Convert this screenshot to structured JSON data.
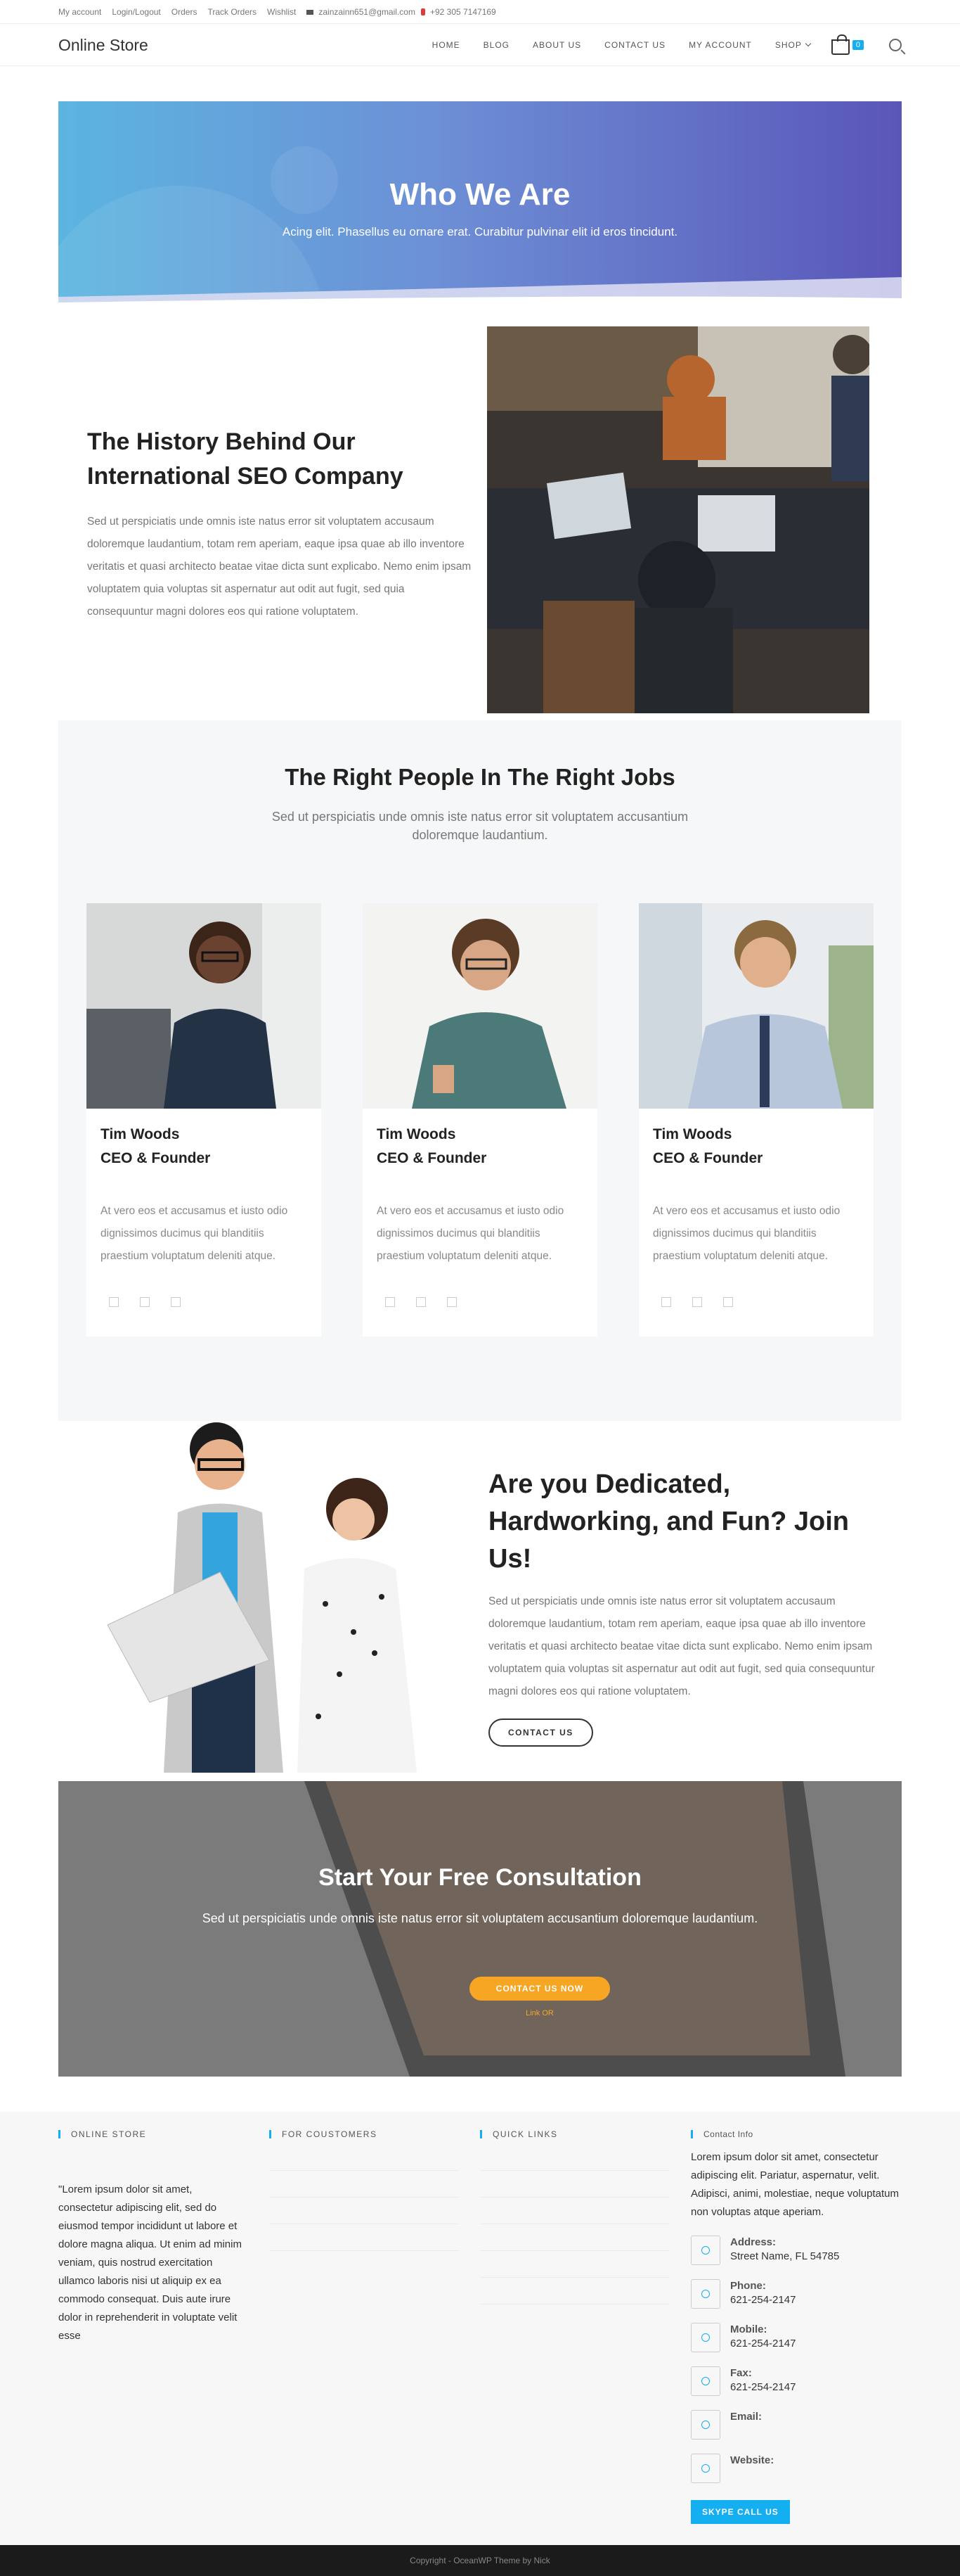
{
  "topbar": {
    "links": [
      "My account",
      "Login/Logout",
      "Orders",
      "Track Orders",
      "Wishlist"
    ],
    "email": "zainzainn651@gmail.com",
    "phone": "+92 305 7147169"
  },
  "header": {
    "logo": "Online Store",
    "nav": [
      "HOME",
      "BLOG",
      "ABOUT US",
      "CONTACT US",
      "MY ACCOUNT",
      "SHOP"
    ],
    "cart_count": "0"
  },
  "hero": {
    "title": "Who We Are",
    "subtitle": "Acing elit. Phasellus eu ornare erat. Curabitur pulvinar elit id eros tincidunt."
  },
  "history": {
    "title": "The History Behind Our International SEO Company",
    "text": "Sed ut perspiciatis unde omnis iste natus error sit voluptatem accusaum doloremque laudantium, totam rem aperiam, eaque ipsa quae ab illo inventore veritatis et quasi architecto beatae vitae dicta sunt explicabo. Nemo enim ipsam voluptatem quia voluptas sit aspernatur aut odit aut fugit, sed quia consequuntur magni dolores eos qui ratione voluptatem."
  },
  "people": {
    "title": "The Right People In The Right Jobs",
    "subtitle": "Sed ut perspiciatis unde omnis iste natus error sit voluptatem accusantium doloremque laudantium.",
    "cards": [
      {
        "name": "Tim Woods",
        "role": "CEO & Founder",
        "text": "At vero eos et accusamus et iusto odio dignissimos ducimus qui blanditiis praestium voluptatum deleniti atque."
      },
      {
        "name": "Tim Woods",
        "role": "CEO & Founder",
        "text": "At vero eos et accusamus et iusto odio dignissimos ducimus qui blanditiis praestium voluptatum deleniti atque."
      },
      {
        "name": "Tim Woods",
        "role": "CEO & Founder",
        "text": "At vero eos et accusamus et iusto odio dignissimos ducimus qui blanditiis praestium voluptatum deleniti atque."
      }
    ]
  },
  "join": {
    "title": "Are you Dedicated, Hardworking, and Fun? Join Us!",
    "text": "Sed ut perspiciatis unde omnis iste natus error sit voluptatem accusaum doloremque laudantium, totam rem aperiam, eaque ipsa quae ab illo inventore veritatis et quasi architecto beatae vitae dicta sunt explicabo. Nemo enim ipsam voluptatem quia voluptas sit aspernatur aut odit aut fugit, sed quia consequuntur magni dolores eos qui ratione voluptatem.",
    "button": "CONTACT US"
  },
  "consult": {
    "title": "Start Your Free Consultation",
    "text": "Sed ut perspiciatis unde omnis iste natus error sit voluptatem accusantium doloremque laudantium.",
    "button": "CONTACT US NOW",
    "sublink": "Link OR"
  },
  "footer": {
    "col1_title": "ONLINE STORE",
    "col1_text": "\"Lorem ipsum dolor sit amet, consectetur adipiscing elit, sed do eiusmod tempor incididunt ut labore et dolore magna aliqua. Ut enim ad minim veniam, quis nostrud exercitation ullamco laboris nisi ut aliquip ex ea commodo consequat. Duis aute irure dolor in reprehenderit in voluptate velit esse",
    "col2_title": "FOR COUSTOMERS",
    "col3_title": "QUICK LINKS",
    "col4_title": "Contact Info",
    "contact_intro": "Lorem ipsum dolor sit amet, consectetur adipiscing elit. Pariatur, aspernatur, velit. Adipisci, animi, molestiae, neque voluptatum non voluptas atque aperiam.",
    "address_label": "Address:",
    "address": "Street Name, FL 54785",
    "phone_label": "Phone:",
    "phone": "621-254-2147",
    "mobile_label": "Mobile:",
    "mobile": "621-254-2147",
    "fax_label": "Fax:",
    "fax": "621-254-2147",
    "email_label": "Email:",
    "website_label": "Website:",
    "skype": "SKYPE CALL US",
    "copyright": "Copyright - OceanWP Theme by Nick"
  },
  "colors": {
    "accent": "#13aff0",
    "cta": "#f6a623"
  },
  "icons": [
    "mail-icon",
    "phone-icon",
    "cart-icon",
    "search-icon",
    "chevron-down-icon",
    "location-icon",
    "mobile-icon",
    "fax-icon",
    "link-icon"
  ]
}
